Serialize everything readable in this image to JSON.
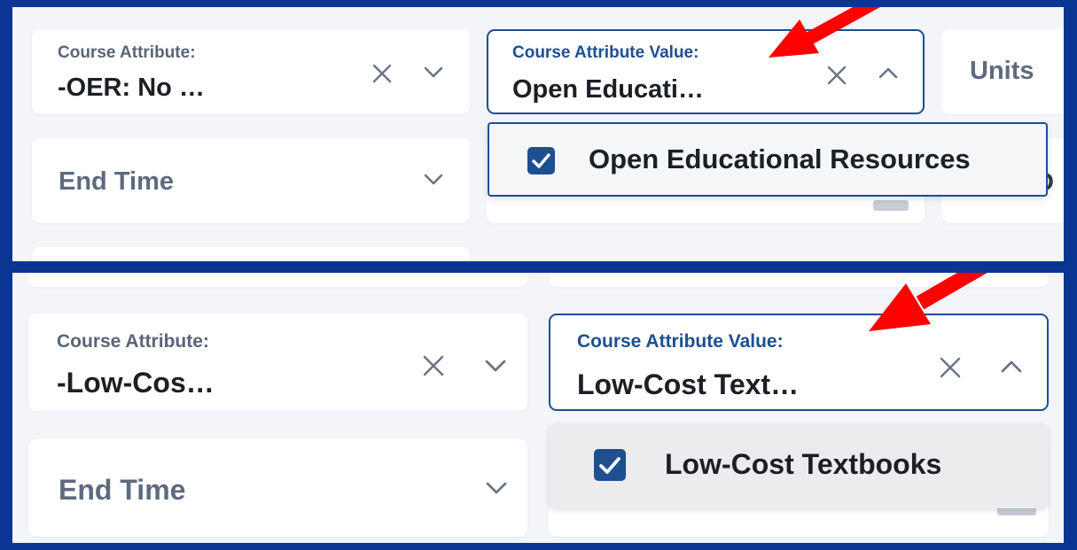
{
  "top": {
    "attribute": {
      "label": "Course Attribute:",
      "value": "-OER: No …"
    },
    "attribute_value": {
      "label": "Course Attribute Value:",
      "value": "Open Educati…"
    },
    "units": {
      "label": "Units"
    },
    "end_time": {
      "placeholder": "End Time"
    },
    "dropdown": {
      "option": "Open Educational Resources",
      "checked": true
    },
    "partial_letter": "D"
  },
  "bottom": {
    "attribute": {
      "label": "Course Attribute:",
      "value": "-Low-Cos…"
    },
    "attribute_value": {
      "label": "Course Attribute Value:",
      "value": "Low-Cost Text…"
    },
    "end_time": {
      "placeholder": "End Time"
    },
    "dropdown": {
      "option": "Low-Cost Textbooks",
      "checked": true
    }
  },
  "colors": {
    "frame": "#0a3592",
    "panel": "#f3f5f9",
    "accent": "#1d4f91",
    "arrow": "#ff0000"
  },
  "icons": [
    "clear-icon",
    "chevron-down-icon",
    "chevron-up-icon",
    "checkbox-checked-icon",
    "annotation-arrow"
  ]
}
